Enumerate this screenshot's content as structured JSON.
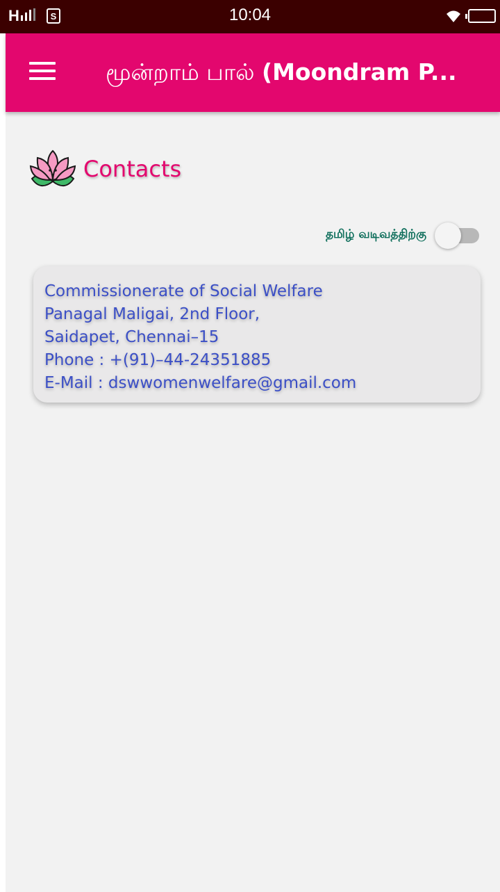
{
  "status_bar": {
    "carrier": "H",
    "sim_badge": "S",
    "time": "10:04"
  },
  "app_bar": {
    "title_tamil": "மூன்றாம் பால் ",
    "title_english": "(Moondram P..."
  },
  "section": {
    "title": "Contacts",
    "icon": "lotus-icon"
  },
  "language_toggle": {
    "label": "தமிழ் வடிவத்திற்கு",
    "checked": false
  },
  "contact": {
    "lines": [
      "Commissionerate of Social Welfare",
      "Panagal Maligai, 2nd Floor,",
      "Saidapet, Chennai–15",
      "Phone : +(91)–44-24351885",
      "E-Mail : dswwomenwelfare@gmail.com"
    ]
  },
  "colors": {
    "primary": "#e3076e",
    "status_bar": "#3b0000",
    "background": "#f2f2f2",
    "contact_text": "#3b4fc6",
    "toggle_label": "#0e6e5b"
  }
}
